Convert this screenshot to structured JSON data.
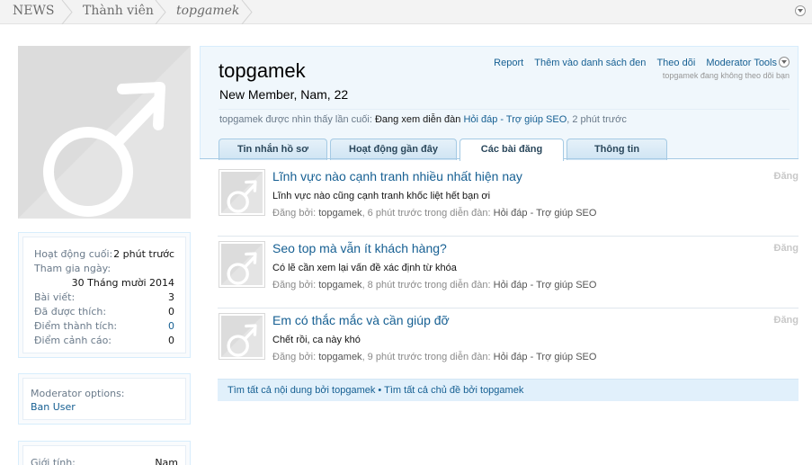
{
  "breadcrumb": [
    "NEWS",
    "Thành viên",
    "topgamek"
  ],
  "sidebar": {
    "stats": [
      {
        "label": "Hoạt động cuối:",
        "value": "2 phút trước"
      },
      {
        "label": "Tham gia ngày:",
        "value": ""
      },
      {
        "label": "",
        "value": "30 Tháng mười 2014"
      },
      {
        "label": "Bài viết:",
        "value": "3"
      },
      {
        "label": "Đã được thích:",
        "value": "0"
      },
      {
        "label": "Điểm thành tích:",
        "value": "0"
      },
      {
        "label": "Điểm cảnh cáo:",
        "value": "0"
      }
    ],
    "moderator_label": "Moderator options:",
    "ban_user": "Ban User",
    "gender_label": "Giới tính:",
    "gender_value": "Nam"
  },
  "profile": {
    "username": "topgamek",
    "title": "New Member, Nam, 22",
    "actions": [
      "Report",
      "Thêm vào danh sách đen",
      "Theo dõi",
      "Moderator Tools"
    ],
    "follow_status": "topgamek đang không theo dõi bạn",
    "last_seen_prefix": "topgamek được nhìn thấy lần cuối:",
    "last_seen_activity": "Đang xem diễn đàn",
    "last_seen_forum": "Hỏi đáp - Trợ giúp SEO",
    "last_seen_time": ", 2 phút trước"
  },
  "tabs": [
    "Tin nhắn hồ sơ",
    "Hoạt động gần đây",
    "Các bài đăng",
    "Thông tin"
  ],
  "active_tab": 2,
  "posts": [
    {
      "title": "Lĩnh vực nào cạnh tranh nhiều nhất hiện nay",
      "snippet": "Lĩnh vực nào cũng cạnh tranh khốc liệt hết bạn ơi",
      "meta_prefix": "Đăng bởi: ",
      "author": "topgamek",
      "time": ", 6 phút trước trong diễn đàn: ",
      "forum": "Hỏi đáp - Trợ giúp SEO",
      "type": "Đăng"
    },
    {
      "title": "Seo top mà vẫn ít khách hàng?",
      "snippet": "Có lẽ cần xem lại vấn đề xác định từ khóa",
      "meta_prefix": "Đăng bởi: ",
      "author": "topgamek",
      "time": ", 8 phút trước trong diễn đàn: ",
      "forum": "Hỏi đáp - Trợ giúp SEO",
      "type": "Đăng"
    },
    {
      "title": "Em có thắc mắc và cần giúp đỡ",
      "snippet": "Chết rồi, ca này khó",
      "meta_prefix": "Đăng bởi: ",
      "author": "topgamek",
      "time": ", 9 phút trước trong diễn đàn: ",
      "forum": "Hỏi đáp - Trợ giúp SEO",
      "type": "Đăng"
    }
  ],
  "find_links": [
    "Tìm tất cả nội dung bởi topgamek",
    "Tìm tất cả chủ đề bởi topgamek"
  ],
  "find_separator": "•",
  "colors": {
    "link": "#176093",
    "accent_bg": "#f0f7fc",
    "tab_border": "#a5cae4"
  },
  "icons": {
    "avatar": "male-symbol-icon",
    "menu": "chevron-down-icon"
  }
}
